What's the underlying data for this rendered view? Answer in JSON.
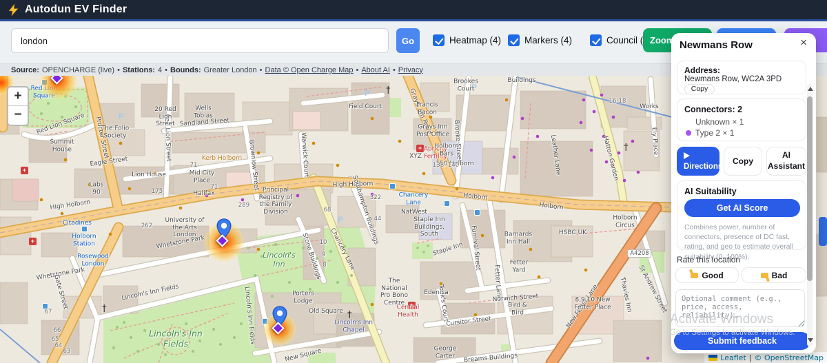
{
  "navbar": {
    "title": "Autodun EV Finder"
  },
  "toolbar": {
    "search_value": "london",
    "go_label": "Go",
    "heatmap_label": "Heatmap (4)",
    "markers_label": "Markers (4)",
    "council_label": "Council (∞)",
    "zoom_button_label": "Zoom"
  },
  "sourcebar": {
    "source_label": "Source:",
    "source_value": "OPENCHARGE (live)",
    "stations_label": "Stations:",
    "stations_value": "4",
    "bounds_label": "Bounds:",
    "bounds_value": "Greater London",
    "sep": "•",
    "link_data": "Data © Open Charge Map",
    "link_about": "About AI",
    "link_privacy": "Privacy"
  },
  "map": {
    "zoom_in": "+",
    "zoom_out": "−",
    "attribution": {
      "leaflet": "Leaflet",
      "divider": "|",
      "osm": "© OpenStreetMap"
    },
    "labels": {
      "red_lion_square_place": "Red Lion Square",
      "red_lion_square_street": "Red Lion Square",
      "eagle_street": "Eagle Street",
      "sandland_street": "Sandland Street",
      "procter_street": "Procter Street",
      "red_lion_street": "Red Lion Street",
      "red_lion_street_20": "20 Red Lion Street",
      "brownlow_street": "Brownlow Street",
      "warwick_court": "Warwick Court",
      "high_holborn_w": "High Holborn",
      "high_holborn_c": "High Holborn",
      "holborn_c": "Holborn",
      "holborn_e": "Holborn",
      "grays_inn_road": "Gray's Inn Road",
      "brooke_street": "Brooke Street",
      "brookes_court": "Brookes Court",
      "buildings": "Buildings",
      "leather_lane": "Leather Lane",
      "hatton_garden": "Hatton Garden",
      "ely_place": "Ely Place",
      "works": "Works",
      "n16_18": "16-18",
      "chancery_lane_station": "Chancery Lane",
      "chancery_lane_road": "Chancery Lane",
      "southampton_buildings": "Southampton Buildings",
      "stone_buildings": "Stone Buildings",
      "whetstone_park_w": "Whetstone Park",
      "whetstone_park_e": "Whetstone Park",
      "gate_street": "Gate Street",
      "lincolns_inn_fields_street": "Lincoln's Inn Fields",
      "lincolns_inn_fields_street_e": "Lincoln's Inn Fields",
      "lincolns_inn_fields_park": "Lincoln's Inn Fields",
      "lincolns_inn": "Lincoln's Inn",
      "new_square": "New Square",
      "old_square": "Old Square",
      "porters_lodge": "Porters Lodge",
      "lincolns_inn_chapel": "Lincoln's Inn Chapel",
      "staple_inn": "Staple Inn",
      "staple_inn_buildings_south": "Staple Inn Buildings, South",
      "furnival_street": "Furnival Street",
      "fetter_lane": "Fetter Lane",
      "norwich_street": "Norwich Street",
      "cursitor_street": "Cursitor Street",
      "tooks_court": "Took's Court",
      "breams_buildings": "Breams Buildings",
      "new_fetter_lane": "New Fetter Lane",
      "st_andrew_street": "St Andrew Street",
      "thavies_inn": "Thavies Inn",
      "holborn_circus": "Holborn Circus",
      "a4208": "A4208",
      "field_court": "Field Court",
      "grays_inn_post_office": "Grays Inn Post Office",
      "apricity": "Apricity Fertility",
      "xyz": "XYZ",
      "holborn_150": "150 Holborn",
      "holborn_bars": "Holborn Bars",
      "holborn_bars_no": "138 -140",
      "wells_tobias": "Wells Tobias",
      "folio_society": "The Folio Society",
      "summit_house": "Summit House",
      "lion_house": "Lion House",
      "labs": "Labs 90",
      "mid_city_place": "Mid City Place",
      "halifax": "Halifax",
      "university_arts": "University of the Arts London",
      "principal_registry": "Principal Registry of the Family Division",
      "citadines": "Citadines",
      "holborn_station": "Holborn Station",
      "rosewood_london": "Rosewood London",
      "natwest": "NatWest",
      "hsbc": "HSBC UK",
      "barnards_inn_hall": "Barnards Inn Hall",
      "fetter_yard": "Fetter Yard",
      "central_health": "Central Health",
      "pro_bono": "The National Pro Bono Centre",
      "edenica": "Edenica",
      "bird_bird": "Bird & Bird",
      "george_carter": "George Carter",
      "new_fetter_place": "8,9,10 New Fetter Place",
      "kerb_holborn": "Kerb Holborn",
      "francis_bacon": "Francis Bacon",
      "n289": "289",
      "n262": "262",
      "n322": "322",
      "n68": "68",
      "n44": "44",
      "n175": "175",
      "n71a": "71",
      "n71b": "71",
      "n67": "67",
      "n66": "66",
      "n65": "65",
      "n64": "64",
      "n63": "63",
      "n10": "10",
      "n9": "9",
      "n8": "8"
    }
  },
  "panel": {
    "title": "Newmans Row",
    "close": "×",
    "address_label": "Address:",
    "address": "Newmans Row, WC2A 3PD",
    "copy_small": "Copy",
    "connectors_title": "Connectors: 2",
    "connector_unknown": "Unknown × 1",
    "connector_type2": "Type 2 × 1",
    "directions": "Directions",
    "copy": "Copy",
    "ai_assistant": "AI Assistant",
    "ai_suitability": "AI Suitability",
    "get_ai_score": "Get AI Score",
    "ai_description": "Combines power, number of connectors, presence of DC fast, rating, and geo to estimate overall suitability (0–100%).",
    "rate_label": "Rate this location",
    "good": "Good",
    "bad": "Bad",
    "comment_placeholder": "Optional comment (e.g., price, access, reliability)…",
    "submit": "Submit feedback"
  },
  "watermark": {
    "line1": "Activate Windows",
    "line2": "Go to Settings to activate Windows."
  },
  "colors": {
    "accent_blue": "#2a5ce8",
    "go_blue": "#4c86f0",
    "green_button": "#0fa968",
    "purple_button": "#8b5cf6",
    "type2_dot": "#a855f7",
    "marker_purple": "#8124e0",
    "pin_blue": "#3a7bf0"
  }
}
